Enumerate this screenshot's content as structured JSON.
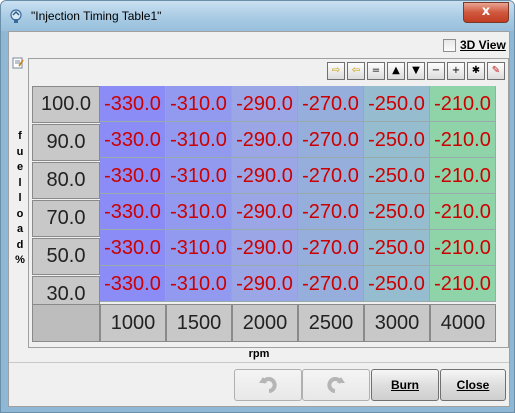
{
  "window": {
    "title": "\"Injection Timing Table1\"",
    "close_glyph": "x"
  },
  "view3d": {
    "label": "3D View",
    "checked": false
  },
  "y_axis_label_letters": [
    "f",
    "u",
    "e",
    "l",
    "l",
    "o",
    "a",
    "d",
    "%"
  ],
  "x_axis_label": "rpm",
  "toolbar": {
    "icons": [
      "arrow-right-icon",
      "arrow-left-icon",
      "equals-icon",
      "increment-icon",
      "decrement-icon",
      "minus-icon",
      "plus-icon",
      "multiply-icon",
      "pencil-icon"
    ],
    "glyphs": [
      "⇨",
      "⇦",
      "=",
      "▲",
      "▼",
      "−",
      "+",
      "✱",
      "✎"
    ]
  },
  "table": {
    "rows": [
      {
        "load": "100.0",
        "values": [
          "-330.0",
          "-310.0",
          "-290.0",
          "-270.0",
          "-250.0",
          "-210.0"
        ]
      },
      {
        "load": "90.0",
        "values": [
          "-330.0",
          "-310.0",
          "-290.0",
          "-270.0",
          "-250.0",
          "-210.0"
        ]
      },
      {
        "load": "80.0",
        "values": [
          "-330.0",
          "-310.0",
          "-290.0",
          "-270.0",
          "-250.0",
          "-210.0"
        ]
      },
      {
        "load": "70.0",
        "values": [
          "-330.0",
          "-310.0",
          "-290.0",
          "-270.0",
          "-250.0",
          "-210.0"
        ]
      },
      {
        "load": "50.0",
        "values": [
          "-330.0",
          "-310.0",
          "-290.0",
          "-270.0",
          "-250.0",
          "-210.0"
        ]
      },
      {
        "load": "30.0",
        "values": [
          "-330.0",
          "-310.0",
          "-290.0",
          "-270.0",
          "-250.0",
          "-210.0"
        ]
      }
    ],
    "rpm": [
      "1000",
      "1500",
      "2000",
      "2500",
      "3000",
      "4000"
    ],
    "column_colors": [
      "#8c8cf7",
      "#929af0",
      "#9aa6e6",
      "#95aedb",
      "#96bcd0",
      "#8ed4a8"
    ]
  },
  "buttons": {
    "undo_disabled": true,
    "redo_disabled": true,
    "burn_label": "Burn",
    "close_label": "Close"
  },
  "colors": {
    "value_text": "#cc0000"
  }
}
